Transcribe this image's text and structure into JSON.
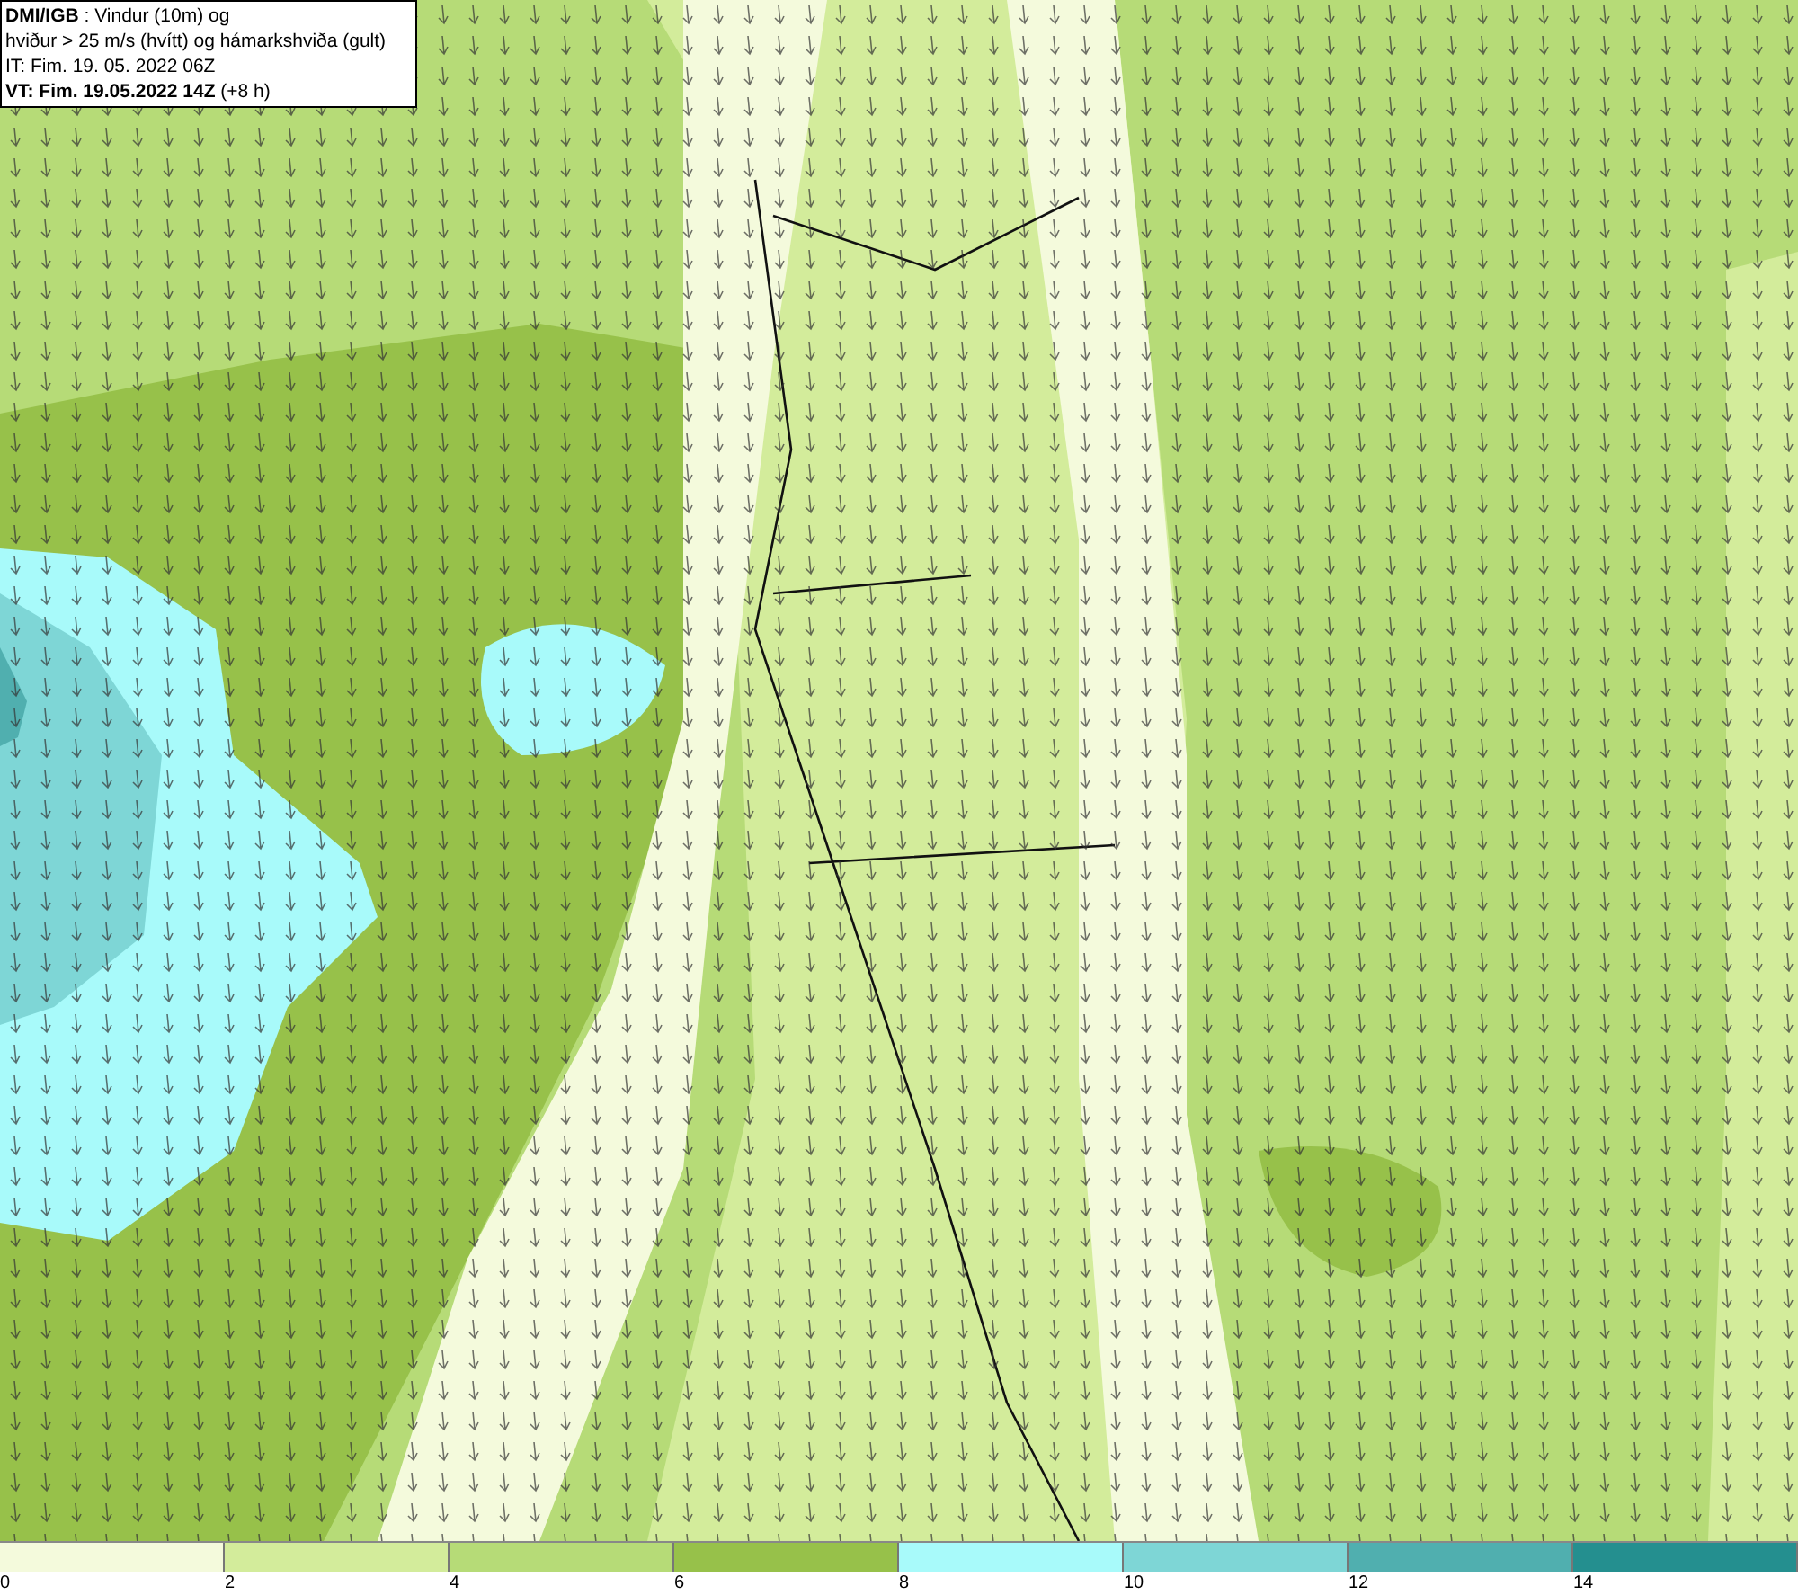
{
  "header": {
    "lines": [
      "**DMI/IGB** : Vindur (10m) og",
      "hviður > 25 m/s (hvítt) og hámarkshviða (gult)",
      "IT: Fim. 19. 05. 2022 06Z",
      "**VT: Fim. 19.05.2022 14Z** (+8 h)"
    ]
  },
  "legend": [
    {
      "label": "0",
      "color": "#f4fadc"
    },
    {
      "label": "2",
      "color": "#d3ec9b"
    },
    {
      "label": "4",
      "color": "#b6db77"
    },
    {
      "label": "6",
      "color": "#97c14a"
    },
    {
      "label": "8",
      "color": "#a8fafa"
    },
    {
      "label": "10",
      "color": "#7ed6d6"
    },
    {
      "label": "12",
      "color": "#50afaf"
    },
    {
      "label": "14",
      "color": "#248f8f"
    }
  ]
}
